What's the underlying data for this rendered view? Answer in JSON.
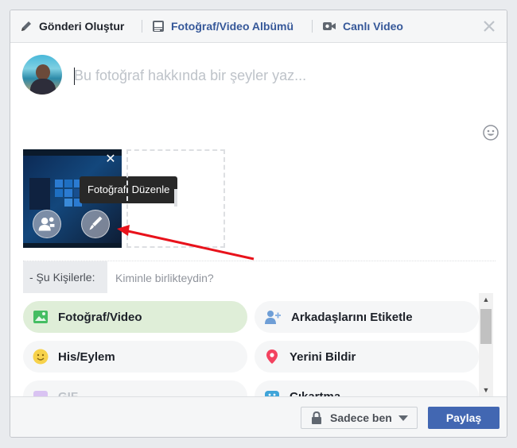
{
  "header": {
    "tabs": [
      {
        "label": "Gönderi Oluştur",
        "icon": "pencil-icon"
      },
      {
        "label": "Fotoğraf/Video Albümü",
        "icon": "album-icon"
      },
      {
        "label": "Canlı Video",
        "icon": "video-camera-icon"
      }
    ]
  },
  "composer": {
    "placeholder": "Bu fotoğraf hakkında bir şeyler yaz..."
  },
  "photo": {
    "tooltip": "Fotoğrafı Düzenle"
  },
  "with": {
    "label": "- Şu Kişilerle:",
    "placeholder": "Kiminle birlikteydin?"
  },
  "actions": [
    {
      "label": "Fotoğraf/Video",
      "icon": "photo-icon",
      "active": true
    },
    {
      "label": "Arkadaşlarını Etiketle",
      "icon": "tag-friends-icon"
    },
    {
      "label": "His/Eylem",
      "icon": "smiley-icon"
    },
    {
      "label": "Yerini Bildir",
      "icon": "location-pin-icon"
    },
    {
      "label": "GIF",
      "icon": "gif-icon"
    },
    {
      "label": "Çıkartma",
      "icon": "sticker-icon"
    }
  ],
  "footer": {
    "privacy_label": "Sadece ben",
    "share_label": "Paylaş"
  },
  "colors": {
    "brand": "#4267b2",
    "link": "#365899",
    "active_pill": "#dfeed8",
    "arrow": "#e8121b"
  }
}
